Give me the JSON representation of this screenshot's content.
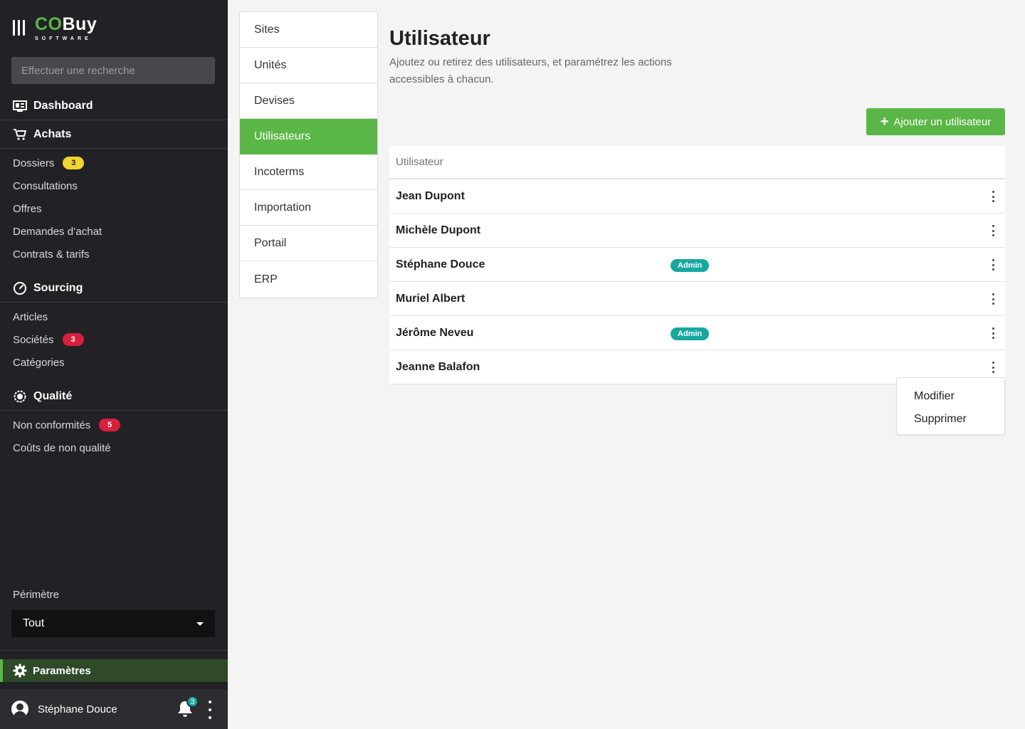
{
  "brand": {
    "co": "CO",
    "buy": "Buy",
    "sub": "SOFTWARE"
  },
  "search": {
    "placeholder": "Effectuer une recherche"
  },
  "sidebar": {
    "dashboard": "Dashboard",
    "achats": {
      "label": "Achats",
      "items": [
        {
          "label": "Dossiers",
          "badge": "3"
        },
        {
          "label": "Consultations"
        },
        {
          "label": "Offres"
        },
        {
          "label": "Demandes d’achat"
        },
        {
          "label": "Contrats & tarifs"
        }
      ]
    },
    "sourcing": {
      "label": "Sourcing",
      "items": [
        {
          "label": "Articles"
        },
        {
          "label": "Sociétés",
          "badge": "3"
        },
        {
          "label": "Catégories"
        }
      ]
    },
    "qualite": {
      "label": "Qualité",
      "items": [
        {
          "label": "Non conformités",
          "badge": "5"
        },
        {
          "label": "Coûts de non qualité"
        }
      ]
    },
    "perimetre": {
      "label": "Périmètre",
      "value": "Tout"
    },
    "parametres": "Paramètres",
    "user": {
      "name": "Stéphane Douce",
      "notifications": "3"
    }
  },
  "settings_menu": [
    "Sites",
    "Unités",
    "Devises",
    "Utilisateurs",
    "Incoterms",
    "Importation",
    "Portail",
    "ERP"
  ],
  "main": {
    "title": "Utilisateur",
    "description": "Ajoutez ou retirez des utilisateurs, et paramétrez les actions accessibles à chacun.",
    "add_button": "Ajouter un utilisateur",
    "table_header": "Utilisateur",
    "users": [
      {
        "name": "Jean Dupont"
      },
      {
        "name": "Michèle Dupont"
      },
      {
        "name": "Stéphane Douce",
        "role": "Admin"
      },
      {
        "name": "Muriel Albert"
      },
      {
        "name": "Jérôme Neveu",
        "role": "Admin"
      },
      {
        "name": "Jeanne Balafon"
      }
    ],
    "row_menu": {
      "edit": "Modifier",
      "delete": "Supprimer"
    }
  },
  "colors": {
    "accent": "#5ab646",
    "sidebar": "#222226",
    "admin_badge": "#17a8a0",
    "alert_badge": "#d81f3d",
    "warning_badge": "#f2d330"
  }
}
